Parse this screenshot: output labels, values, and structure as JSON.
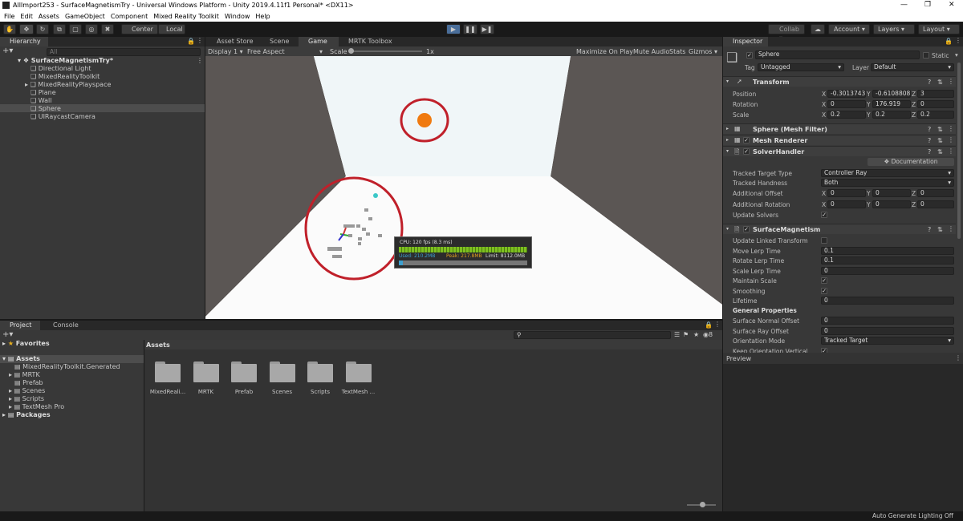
{
  "window": {
    "title": "AllImport253 - SurfaceMagnetismTry - Universal Windows Platform - Unity 2019.4.11f1 Personal* <DX11>"
  },
  "menu": [
    "File",
    "Edit",
    "Assets",
    "GameObject",
    "Component",
    "Mixed Reality Toolkit",
    "Window",
    "Help"
  ],
  "toolbar": {
    "center": "Center",
    "local": "Local",
    "collab": "Collab",
    "account": "Account",
    "layers": "Layers",
    "layout": "Layout"
  },
  "hierarchy": {
    "tab": "Hierarchy",
    "search_placeholder": "All",
    "root": "SurfaceMagnetismTry*",
    "items": [
      "Directional Light",
      "MixedRealityToolkit",
      "MixedRealityPlayspace",
      "Plane",
      "Wall",
      "Sphere",
      "UIRaycastCamera"
    ]
  },
  "center_tabs": [
    "Asset Store",
    "Scene",
    "Game",
    "MRTK Toolbox"
  ],
  "game_bar": {
    "display": "Display 1",
    "aspect": "Free Aspect",
    "scale_label": "Scale",
    "scale_value": "1x",
    "maximize": "Maximize On Play",
    "mute": "Mute Audio",
    "stats": "Stats",
    "gizmos": "Gizmos"
  },
  "profiler": {
    "cpu": "CPU: 120 fps (8.3 ms)",
    "used": "Used: 210.2MB",
    "peak": "Peak: 217.8MB",
    "limit": "Limit: 8112.0MB"
  },
  "inspector": {
    "tab": "Inspector",
    "object_name": "Sphere",
    "static_label": "Static",
    "tag_label": "Tag",
    "tag": "Untagged",
    "layer_label": "Layer",
    "layer": "Default",
    "transform": {
      "title": "Transform",
      "position_label": "Position",
      "position": {
        "x": "-0.3013743",
        "y": "-0.6108808",
        "z": "3"
      },
      "rotation_label": "Rotation",
      "rotation": {
        "x": "0",
        "y": "176.919",
        "z": "0"
      },
      "scale_label": "Scale",
      "scale": {
        "x": "0.2",
        "y": "0.2",
        "z": "0.2"
      }
    },
    "mesh_filter": "Sphere (Mesh Filter)",
    "mesh_renderer": "Mesh Renderer",
    "solver_handler": {
      "title": "SolverHandler",
      "documentation": "Documentation",
      "tracked_target_type_label": "Tracked Target Type",
      "tracked_target_type": "Controller Ray",
      "tracked_handness_label": "Tracked Handness",
      "tracked_handness": "Both",
      "additional_offset_label": "Additional Offset",
      "additional_offset": {
        "x": "0",
        "y": "0",
        "z": "0"
      },
      "additional_rotation_label": "Additional Rotation",
      "additional_rotation": {
        "x": "0",
        "y": "0",
        "z": "0"
      },
      "update_solvers_label": "Update Solvers"
    },
    "surface_magnetism": {
      "title": "SurfaceMagnetism",
      "rows": [
        {
          "label": "Update Linked Transform",
          "value": "",
          "type": "check_off"
        },
        {
          "label": "Move Lerp Time",
          "value": "0.1",
          "type": "field"
        },
        {
          "label": "Rotate Lerp Time",
          "value": "0.1",
          "type": "field"
        },
        {
          "label": "Scale Lerp Time",
          "value": "0",
          "type": "field"
        },
        {
          "label": "Maintain Scale",
          "value": "",
          "type": "check_on"
        },
        {
          "label": "Smoothing",
          "value": "",
          "type": "check_on"
        },
        {
          "label": "Lifetime",
          "value": "0",
          "type": "field"
        }
      ],
      "general_properties": "General Properties",
      "rows2": [
        {
          "label": "Surface Normal Offset",
          "value": "0",
          "type": "field"
        },
        {
          "label": "Surface Ray Offset",
          "value": "0",
          "type": "field"
        },
        {
          "label": "Orientation Mode",
          "value": "Tracked Target",
          "type": "dropdown"
        },
        {
          "label": "Keep Orientation Vertical",
          "value": "",
          "type": "check_on"
        }
      ]
    },
    "preview": "Preview"
  },
  "project": {
    "tabs": [
      "Project",
      "Console"
    ],
    "favorites": "Favorites",
    "assets_root": "Assets",
    "tree": [
      "MixedRealityToolkit.Generated",
      "MRTK",
      "Prefab",
      "Scenes",
      "Scripts",
      "TextMesh Pro"
    ],
    "packages": "Packages",
    "breadcrumb": "Assets",
    "hidden_count": "8",
    "folders": [
      "MixedReali...",
      "MRTK",
      "Prefab",
      "Scenes",
      "Scripts",
      "TextMesh ..."
    ]
  },
  "status_bar": "Auto Generate Lighting Off",
  "colors": {
    "accent": "#3a72b0",
    "play_bg": "#4a6e9a",
    "annotation_red": "#c0202a",
    "sphere_orange": "#f07a10"
  }
}
